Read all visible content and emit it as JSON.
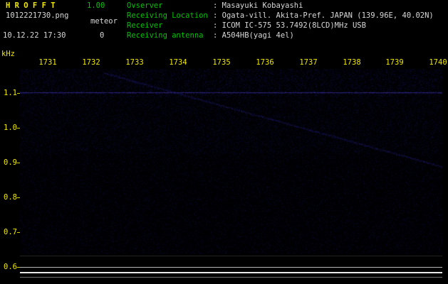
{
  "header": {
    "app_title": "H R O F F T",
    "version": "1.00",
    "filename": "1012221730.png",
    "mode_label": "meteor",
    "datetime": "10.12.22 17:30",
    "meteor_count": "0",
    "info_rows": [
      {
        "label": "Ovserver",
        "value": ": Masayuki Kobayashi"
      },
      {
        "label": "Receiving Location",
        "value": ": Ogata-vill. Akita-Pref. JAPAN (139.96E, 40.02N)"
      },
      {
        "label": "Receiver",
        "value": ": ICOM IC-575 53.7492(8LCD)MHz USB"
      },
      {
        "label": "Receiving antenna",
        "value": ": A504HB(yagi 4el)"
      }
    ]
  },
  "spectrogram": {
    "y_unit": "kHz",
    "time_labels": [
      "1731",
      "1732",
      "1733",
      "1734",
      "1735",
      "1736",
      "1737",
      "1738",
      "1739",
      "1740"
    ],
    "freq_labels": [
      "1.1",
      "1.0",
      "0.9",
      "0.8",
      "0.7",
      "0.6"
    ],
    "axis_color": "#f0e800",
    "noise_color": "#000080",
    "carrier_line_freq_khz": "1.1"
  },
  "colors": {
    "background": "#000000",
    "title_yellow": "#f0e800",
    "label_green": "#00c400",
    "value_white": "#d8d8d8"
  }
}
